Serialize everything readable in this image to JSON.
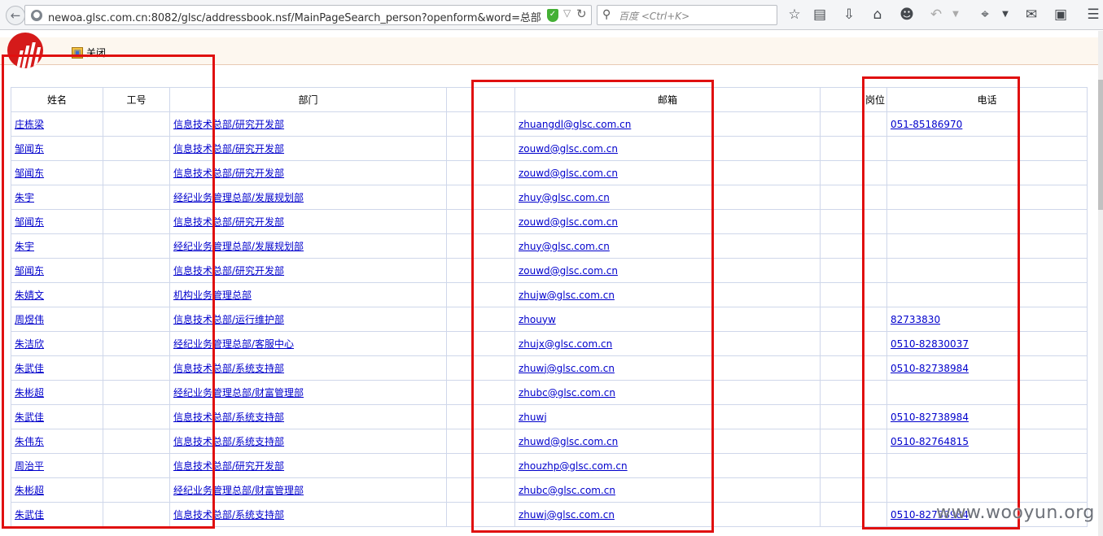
{
  "browser": {
    "url": "newoa.glsc.com.cn:8082/glsc/addressbook.nsf/MainPageSearch_person?openform&word=总部",
    "search_placeholder": "百度 <Ctrl+K>"
  },
  "header": {
    "close_label": "关闭"
  },
  "table": {
    "headers": [
      "姓名",
      "工号",
      "部门",
      "",
      "邮箱",
      "岗位",
      "电话"
    ],
    "rows": [
      {
        "name": "庄栋梁",
        "id": "",
        "dept": "信息技术总部/研究开发部",
        "email": "zhuangdl@glsc.com.cn",
        "post": "",
        "phone": "051-85186970"
      },
      {
        "name": "邹闻东",
        "id": "",
        "dept": "信息技术总部/研究开发部",
        "email": "zouwd@glsc.com.cn",
        "post": "",
        "phone": ""
      },
      {
        "name": "邹闻东",
        "id": "",
        "dept": "信息技术总部/研究开发部",
        "email": "zouwd@glsc.com.cn",
        "post": "",
        "phone": ""
      },
      {
        "name": "朱宇",
        "id": "",
        "dept": "经纪业务管理总部/发展规划部",
        "email": "zhuy@glsc.com.cn",
        "post": "",
        "phone": ""
      },
      {
        "name": "邹闻东",
        "id": "",
        "dept": "信息技术总部/研究开发部",
        "email": "zouwd@glsc.com.cn",
        "post": "",
        "phone": ""
      },
      {
        "name": "朱宇",
        "id": "",
        "dept": "经纪业务管理总部/发展规划部",
        "email": "zhuy@glsc.com.cn",
        "post": "",
        "phone": ""
      },
      {
        "name": "邹闻东",
        "id": "",
        "dept": "信息技术总部/研究开发部",
        "email": "zouwd@glsc.com.cn",
        "post": "",
        "phone": ""
      },
      {
        "name": "朱婧文",
        "id": "",
        "dept": "机构业务管理总部",
        "email": "zhujw@glsc.com.cn",
        "post": "",
        "phone": ""
      },
      {
        "name": "周煜伟",
        "id": "",
        "dept": "信息技术总部/运行维护部",
        "email": "zhouyw",
        "post": "",
        "phone": "82733830"
      },
      {
        "name": "朱洁欣",
        "id": "",
        "dept": "经纪业务管理总部/客服中心",
        "email": "zhujx@glsc.com.cn",
        "post": "",
        "phone": "0510-82830037"
      },
      {
        "name": "朱武佳",
        "id": "",
        "dept": "信息技术总部/系统支持部",
        "email": "zhuwj@glsc.com.cn",
        "post": "",
        "phone": "0510-82738984"
      },
      {
        "name": "朱彬超",
        "id": "",
        "dept": "经纪业务管理总部/财富管理部",
        "email": "zhubc@glsc.com.cn",
        "post": "",
        "phone": ""
      },
      {
        "name": "朱武佳",
        "id": "",
        "dept": "信息技术总部/系统支持部",
        "email": "zhuwj",
        "post": "",
        "phone": "0510-82738984"
      },
      {
        "name": "朱伟东",
        "id": "",
        "dept": "信息技术总部/系统支持部",
        "email": "zhuwd@glsc.com.cn",
        "post": "",
        "phone": "0510-82764815"
      },
      {
        "name": "周治平",
        "id": "",
        "dept": "信息技术总部/研究开发部",
        "email": "zhouzhp@glsc.com.cn",
        "post": "",
        "phone": ""
      },
      {
        "name": "朱彬超",
        "id": "",
        "dept": "经纪业务管理总部/财富管理部",
        "email": "zhubc@glsc.com.cn",
        "post": "",
        "phone": ""
      },
      {
        "name": "朱武佳",
        "id": "",
        "dept": "信息技术总部/系统支持部",
        "email": "zhuwj@glsc.com.cn",
        "post": "",
        "phone": "0510-82738984"
      }
    ]
  },
  "watermark": "www.wooyun.org",
  "colors": {
    "annotation_red": "#e01010",
    "link": "#0000cc",
    "header_bg": "#fdf7ef",
    "logo_red": "#d51a1a"
  },
  "icons": [
    "back-arrow-icon",
    "globe-icon",
    "shield-check-icon",
    "dropdown-arrow-icon",
    "reload-icon",
    "search-icon",
    "star-icon",
    "reading-list-icon",
    "download-icon",
    "home-icon",
    "chat-icon",
    "undo-icon",
    "crop-icon",
    "comment-icon",
    "reader-icon",
    "menu-icon",
    "close-folder-icon"
  ]
}
